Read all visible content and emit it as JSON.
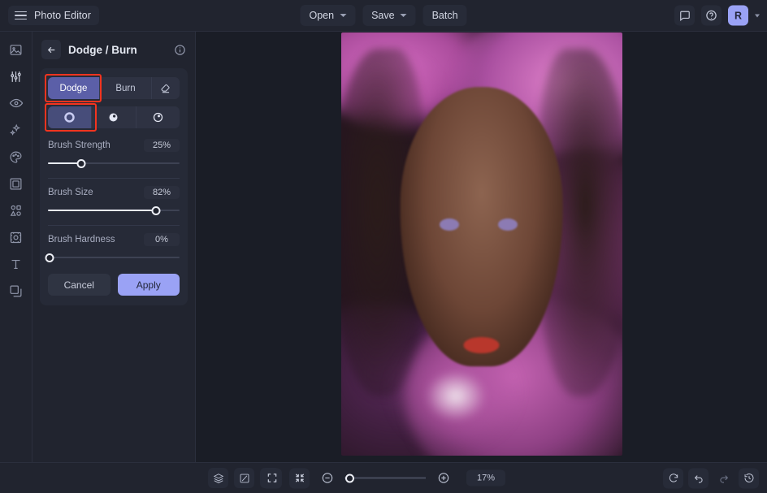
{
  "app": {
    "brand": "Photo Editor",
    "hamburger_icon": "hamburger-menu-icon"
  },
  "topbar": {
    "open_label": "Open",
    "save_label": "Save",
    "batch_label": "Batch",
    "feedback_icon": "comment-icon",
    "help_icon": "help-circle-icon",
    "avatar_initial": "R"
  },
  "rail": {
    "items": [
      {
        "name": "image-icon",
        "label": "Image"
      },
      {
        "name": "adjustments-icon",
        "label": "Adjust"
      },
      {
        "name": "eye-retouch-icon",
        "label": "Retouch"
      },
      {
        "name": "sparkles-effects-icon",
        "label": "Effects"
      },
      {
        "name": "palette-icon",
        "label": "Color"
      },
      {
        "name": "frame-icon",
        "label": "Frame"
      },
      {
        "name": "shapes-icon",
        "label": "Elements"
      },
      {
        "name": "crop-transform-icon",
        "label": "Transform"
      },
      {
        "name": "text-icon",
        "label": "Text"
      },
      {
        "name": "layers-icon",
        "label": "Layers"
      }
    ]
  },
  "panel": {
    "back_icon": "back-arrow-icon",
    "title": "Dodge / Burn",
    "info_icon": "info-circle-icon",
    "modes": [
      {
        "label": "Dodge",
        "active": true
      },
      {
        "label": "Burn",
        "active": false
      }
    ],
    "eraser_icon": "eraser-icon",
    "tones": [
      {
        "name": "midtones-tone-icon",
        "active": true
      },
      {
        "name": "shadows-tone-icon",
        "active": false
      },
      {
        "name": "highlights-tone-icon",
        "active": false
      }
    ],
    "sliders": [
      {
        "label": "Brush Strength",
        "value": "25%",
        "percent": 25
      },
      {
        "label": "Brush Size",
        "value": "82%",
        "percent": 82
      },
      {
        "label": "Brush Hardness",
        "value": "0%",
        "percent": 0
      }
    ],
    "cancel_label": "Cancel",
    "apply_label": "Apply",
    "highlight_color": "#f4341f"
  },
  "bottombar": {
    "layers_icon": "layers-stack-icon",
    "compare_icon": "compare-split-icon",
    "grid_icon": "grid-view-icon",
    "fit_icon": "fit-to-screen-icon",
    "actual_icon": "actual-size-icon",
    "zoom_out_icon": "zoom-out-icon",
    "zoom_in_icon": "zoom-in-icon",
    "zoom_value": "17%",
    "zoom_percent": 17,
    "reset_icon": "reset-rotate-icon",
    "undo_icon": "undo-icon",
    "redo_icon": "redo-icon",
    "history_icon": "history-clock-icon"
  },
  "colors": {
    "accent": "#9aa2f5",
    "active_segment": "#5b5fa8",
    "panel_bg": "#262a37",
    "app_bg": "#21242f",
    "canvas_bg": "#1a1d26"
  }
}
